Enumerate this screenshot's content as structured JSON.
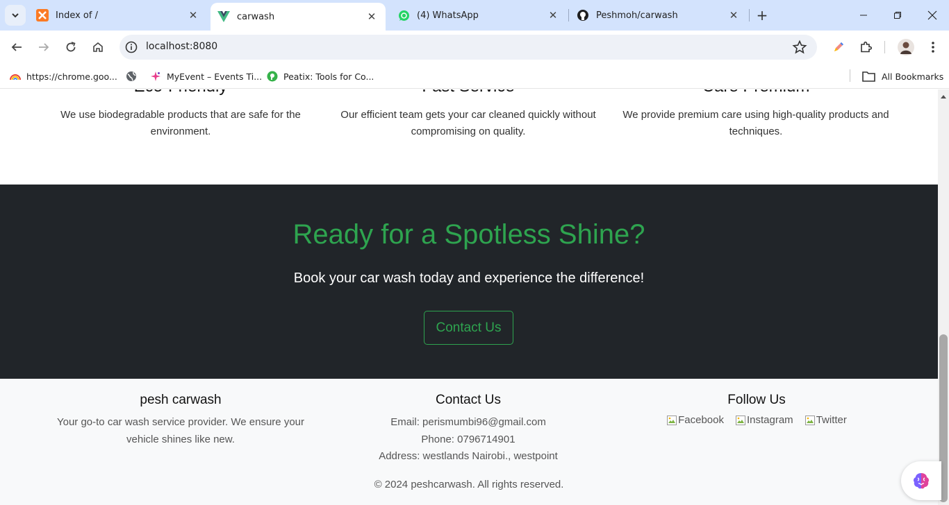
{
  "browser": {
    "tabs": [
      {
        "title": "Index of /",
        "favicon": "xampp-icon"
      },
      {
        "title": "carwash",
        "favicon": "vue-icon"
      },
      {
        "title": "(4) WhatsApp",
        "favicon": "whatsapp-icon"
      },
      {
        "title": "Peshmoh/carwash",
        "favicon": "github-icon"
      }
    ],
    "url": "localhost:8080",
    "bookmarks": [
      {
        "label": "https://chrome.goo..."
      },
      {
        "label": ""
      },
      {
        "label": "MyEvent – Events Ti..."
      },
      {
        "label": "Peatix: Tools for Co..."
      }
    ],
    "all_bookmarks": "All Bookmarks"
  },
  "features": [
    {
      "title": "Eco-Friendly",
      "text": "We use biodegradable products that are safe for the environment."
    },
    {
      "title": "Fast Service",
      "text": "Our efficient team gets your car cleaned quickly without compromising on quality."
    },
    {
      "title": "Care Premium",
      "text": "We provide premium care using high-quality products and techniques."
    }
  ],
  "cta": {
    "heading": "Ready for a Spotless Shine?",
    "subtext": "Book your car wash today and experience the difference!",
    "button": "Contact Us"
  },
  "footer": {
    "brand": {
      "title": "pesh carwash",
      "text": "Your go-to car wash service provider. We ensure your vehicle shines like new."
    },
    "contact": {
      "title": "Contact Us",
      "email": "Email: perismumbi96@gmail.com",
      "phone": "Phone: 0796714901",
      "address": "Address: westlands Nairobi., westpoint"
    },
    "follow": {
      "title": "Follow Us",
      "links": [
        "Facebook",
        "Instagram",
        "Twitter"
      ]
    },
    "copyright": "© 2024 peshcarwash. All rights reserved."
  },
  "colors": {
    "accent": "#2ea44f",
    "dark": "#212529",
    "footer_bg": "#f8f9fa",
    "chrome_bg": "#d3e3fd"
  }
}
